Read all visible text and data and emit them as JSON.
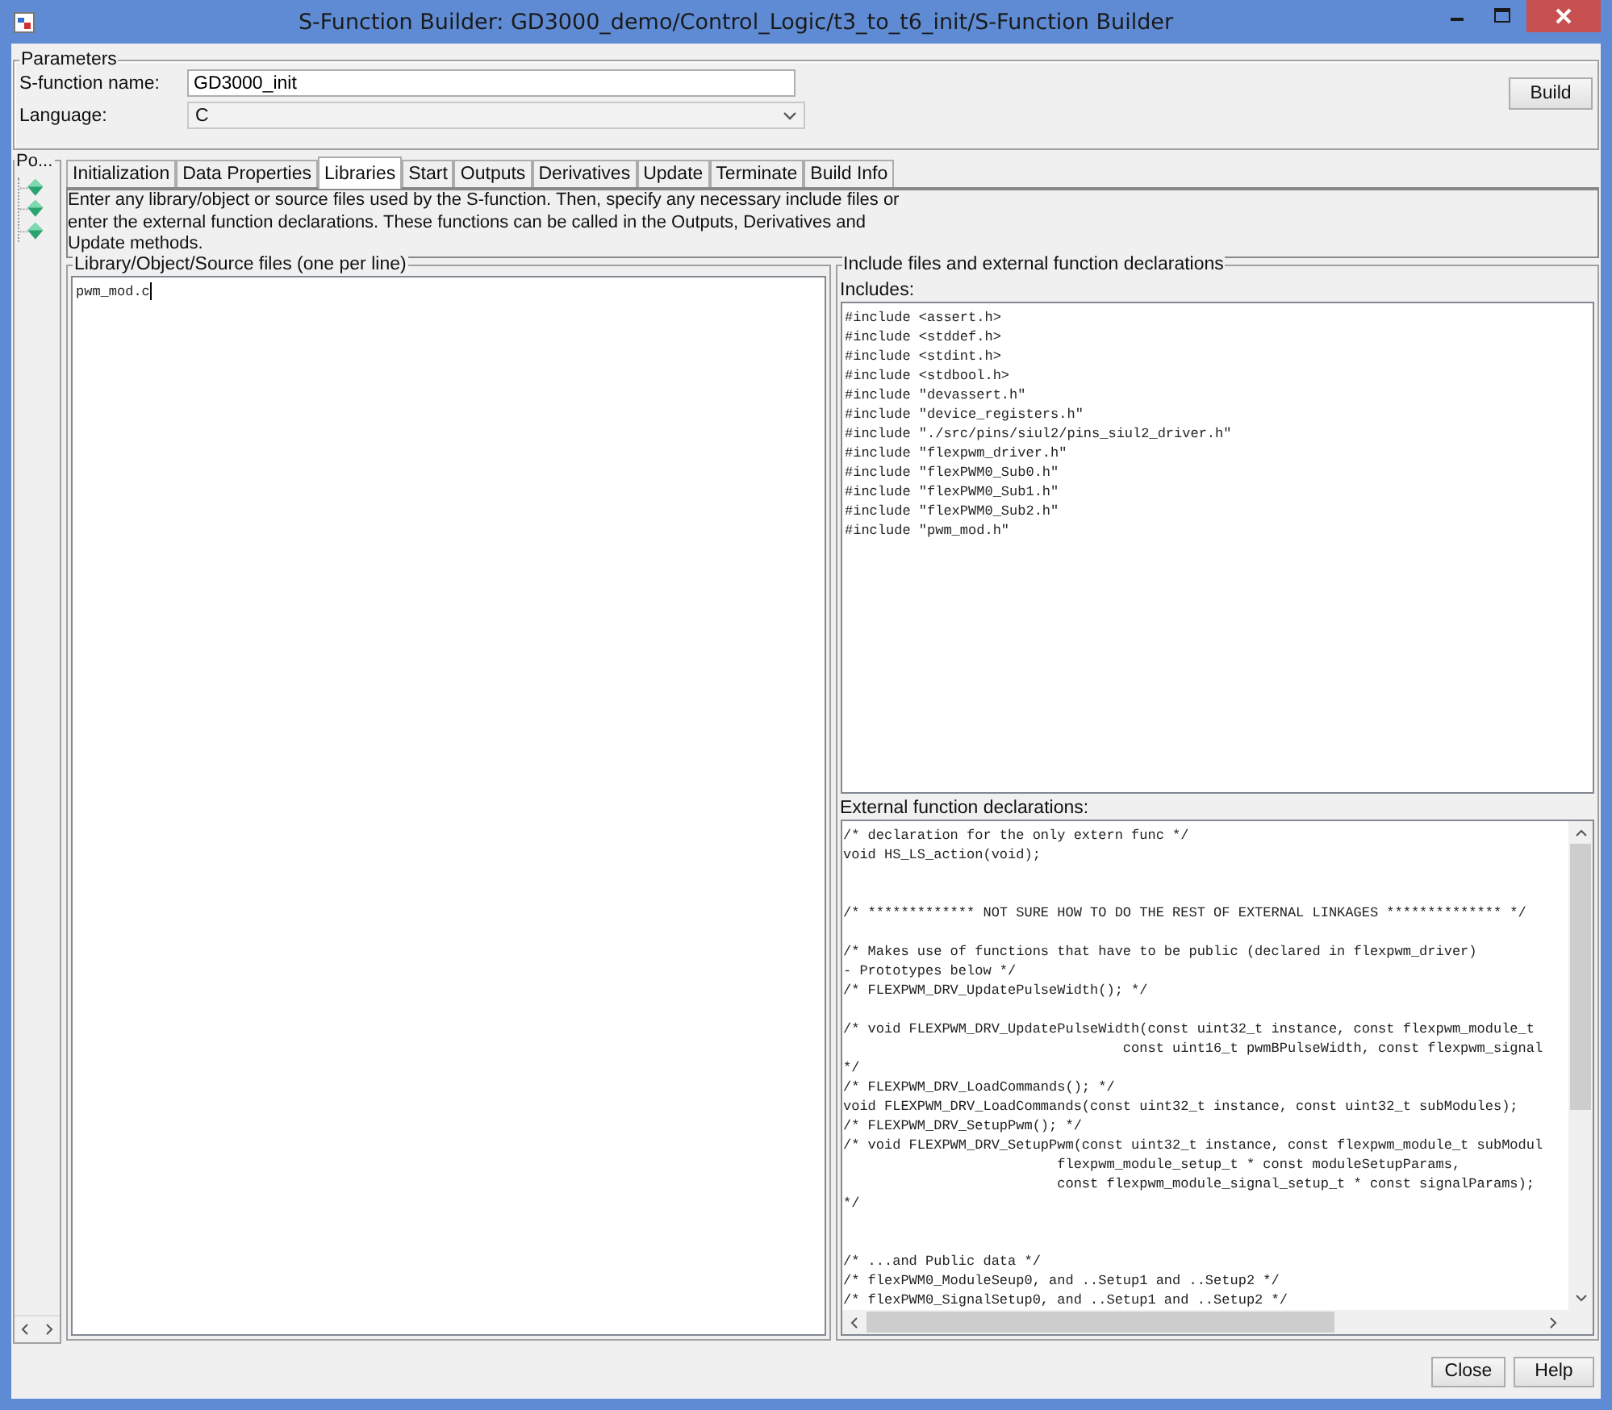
{
  "window": {
    "title": "S-Function Builder: GD3000_demo/Control_Logic/t3_to_t6_init/S-Function Builder"
  },
  "parameters": {
    "title": "Parameters",
    "name_label": "S-function name:",
    "name_value": "GD3000_init",
    "language_label": "Language:",
    "language_value": "C",
    "build_button": "Build"
  },
  "side_panel": {
    "title": "Po..."
  },
  "tabs": [
    {
      "label": "Initialization",
      "selected": false
    },
    {
      "label": "Data Properties",
      "selected": false
    },
    {
      "label": "Libraries",
      "selected": true
    },
    {
      "label": "Start",
      "selected": false
    },
    {
      "label": "Outputs",
      "selected": false
    },
    {
      "label": "Derivatives",
      "selected": false
    },
    {
      "label": "Update",
      "selected": false
    },
    {
      "label": "Terminate",
      "selected": false
    },
    {
      "label": "Build Info",
      "selected": false
    }
  ],
  "description": "Enter any library/object or source files used by the S-function. Then, specify any necessary include files or enter the external function declarations. These functions can be called in the Outputs, Derivatives and Update methods.",
  "library_files": {
    "title": "Library/Object/Source files (one per line)",
    "value": "pwm_mod.c"
  },
  "include_group": {
    "title": "Include files and external function declarations",
    "includes_label": "Includes:",
    "includes": "#include <assert.h>\n#include <stddef.h>\n#include <stdint.h>\n#include <stdbool.h>\n#include \"devassert.h\"\n#include \"device_registers.h\"\n#include \"./src/pins/siul2/pins_siul2_driver.h\"\n#include \"flexpwm_driver.h\"\n#include \"flexPWM0_Sub0.h\"\n#include \"flexPWM0_Sub1.h\"\n#include \"flexPWM0_Sub2.h\"\n#include \"pwm_mod.h\"",
    "external_label": "External function declarations:",
    "external": "/* declaration for the only extern func */\nvoid HS_LS_action(void);\n\n\n/* ************* NOT SURE HOW TO DO THE REST OF EXTERNAL LINKAGES ************** */\n\n/* Makes use of functions that have to be public (declared in flexpwm_driver)\n- Prototypes below */\n/* FLEXPWM_DRV_UpdatePulseWidth(); */\n\n/* void FLEXPWM_DRV_UpdatePulseWidth(const uint32_t instance, const flexpwm_module_t\n                                  const uint16_t pwmBPulseWidth, const flexpwm_signal\n*/\n/* FLEXPWM_DRV_LoadCommands(); */\nvoid FLEXPWM_DRV_LoadCommands(const uint32_t instance, const uint32_t subModules);\n/* FLEXPWM_DRV_SetupPwm(); */\n/* void FLEXPWM_DRV_SetupPwm(const uint32_t instance, const flexpwm_module_t subModul\n                          flexpwm_module_setup_t * const moduleSetupParams,\n                          const flexpwm_module_signal_setup_t * const signalParams);\n*/\n\n\n/* ...and Public data */\n/* flexPWM0_ModuleSeup0, and ..Setup1 and ..Setup2 */\n/* flexPWM0_SignalSetup0, and ..Setup1 and ..Setup2 */"
  },
  "buttons": [
    "Close",
    "Help"
  ]
}
